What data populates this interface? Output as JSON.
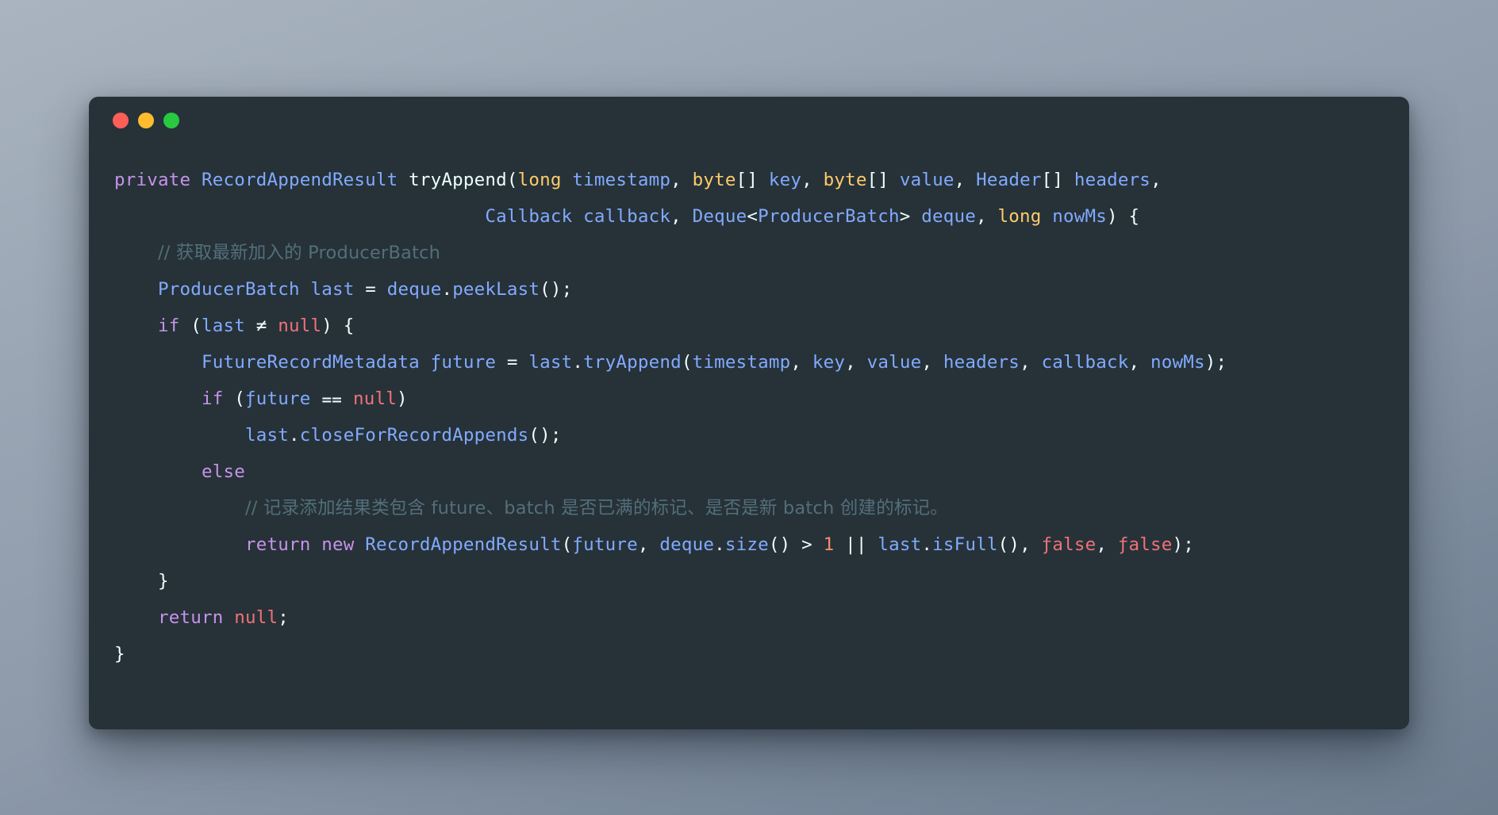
{
  "window": {
    "background_color": "#263238",
    "backdrop_color": "#8e9aaa",
    "traffic_lights": [
      {
        "name": "close",
        "color": "#ff5f57"
      },
      {
        "name": "minimize",
        "color": "#febc2e"
      },
      {
        "name": "maximize",
        "color": "#28c840"
      }
    ]
  },
  "theme": {
    "keyword": "#c792ea",
    "type": "#82aaff",
    "primitive": "#ffcb6b",
    "variable": "#82aaff",
    "null_literal": "#f07178",
    "number": "#f78c6c",
    "comment": "#546e7a",
    "plain": "#eeffff"
  },
  "code": {
    "language": "java",
    "lines": [
      {
        "indent": 0,
        "tokens": [
          {
            "t": "private",
            "c": "kw"
          },
          {
            "t": " ",
            "c": "pln"
          },
          {
            "t": "RecordAppendResult",
            "c": "typ"
          },
          {
            "t": " ",
            "c": "pln"
          },
          {
            "t": "tryAppend",
            "c": "fn"
          },
          {
            "t": "(",
            "c": "pln"
          },
          {
            "t": "long",
            "c": "prim"
          },
          {
            "t": " ",
            "c": "pln"
          },
          {
            "t": "timestamp",
            "c": "var"
          },
          {
            "t": ", ",
            "c": "pln"
          },
          {
            "t": "byte",
            "c": "prim"
          },
          {
            "t": "[] ",
            "c": "pln"
          },
          {
            "t": "key",
            "c": "var"
          },
          {
            "t": ", ",
            "c": "pln"
          },
          {
            "t": "byte",
            "c": "prim"
          },
          {
            "t": "[] ",
            "c": "pln"
          },
          {
            "t": "value",
            "c": "var"
          },
          {
            "t": ", ",
            "c": "pln"
          },
          {
            "t": "Header",
            "c": "typ"
          },
          {
            "t": "[] ",
            "c": "pln"
          },
          {
            "t": "headers",
            "c": "var"
          },
          {
            "t": ",",
            "c": "pln"
          }
        ]
      },
      {
        "indent": 0,
        "lead": "                                  ",
        "tokens": [
          {
            "t": "Callback",
            "c": "typ"
          },
          {
            "t": " ",
            "c": "pln"
          },
          {
            "t": "callback",
            "c": "var"
          },
          {
            "t": ", ",
            "c": "pln"
          },
          {
            "t": "Deque",
            "c": "typ"
          },
          {
            "t": "<",
            "c": "pln"
          },
          {
            "t": "ProducerBatch",
            "c": "typ"
          },
          {
            "t": "> ",
            "c": "pln"
          },
          {
            "t": "deque",
            "c": "var"
          },
          {
            "t": ", ",
            "c": "pln"
          },
          {
            "t": "long",
            "c": "prim"
          },
          {
            "t": " ",
            "c": "pln"
          },
          {
            "t": "nowMs",
            "c": "var"
          },
          {
            "t": ") {",
            "c": "pln"
          }
        ]
      },
      {
        "indent": 1,
        "tokens": [
          {
            "t": "// 获取最新加入的 ProducerBatch",
            "c": "cmt"
          }
        ]
      },
      {
        "indent": 1,
        "tokens": [
          {
            "t": "ProducerBatch",
            "c": "typ"
          },
          {
            "t": " ",
            "c": "pln"
          },
          {
            "t": "last",
            "c": "var"
          },
          {
            "t": " = ",
            "c": "pln"
          },
          {
            "t": "deque",
            "c": "var"
          },
          {
            "t": ".",
            "c": "pln"
          },
          {
            "t": "peekLast",
            "c": "mth"
          },
          {
            "t": "();",
            "c": "pln"
          }
        ]
      },
      {
        "indent": 1,
        "tokens": [
          {
            "t": "if",
            "c": "kw"
          },
          {
            "t": " (",
            "c": "pln"
          },
          {
            "t": "last",
            "c": "var"
          },
          {
            "t": " ≠ ",
            "c": "op"
          },
          {
            "t": "null",
            "c": "nul"
          },
          {
            "t": ") {",
            "c": "pln"
          }
        ]
      },
      {
        "indent": 2,
        "tokens": [
          {
            "t": "FutureRecordMetadata",
            "c": "typ"
          },
          {
            "t": " ",
            "c": "pln"
          },
          {
            "t": "ƒuture",
            "c": "var"
          },
          {
            "t": " = ",
            "c": "pln"
          },
          {
            "t": "last",
            "c": "var"
          },
          {
            "t": ".",
            "c": "pln"
          },
          {
            "t": "tryAppend",
            "c": "mth"
          },
          {
            "t": "(",
            "c": "pln"
          },
          {
            "t": "timestamp",
            "c": "var"
          },
          {
            "t": ", ",
            "c": "pln"
          },
          {
            "t": "key",
            "c": "var"
          },
          {
            "t": ", ",
            "c": "pln"
          },
          {
            "t": "value",
            "c": "var"
          },
          {
            "t": ", ",
            "c": "pln"
          },
          {
            "t": "headers",
            "c": "var"
          },
          {
            "t": ", ",
            "c": "pln"
          },
          {
            "t": "callback",
            "c": "var"
          },
          {
            "t": ", ",
            "c": "pln"
          },
          {
            "t": "nowMs",
            "c": "var"
          },
          {
            "t": ");",
            "c": "pln"
          }
        ]
      },
      {
        "indent": 2,
        "tokens": [
          {
            "t": "if",
            "c": "kw"
          },
          {
            "t": " (",
            "c": "pln"
          },
          {
            "t": "ƒuture",
            "c": "var"
          },
          {
            "t": " ⩵ ",
            "c": "op"
          },
          {
            "t": "null",
            "c": "nul"
          },
          {
            "t": ")",
            "c": "pln"
          }
        ]
      },
      {
        "indent": 3,
        "tokens": [
          {
            "t": "last",
            "c": "var"
          },
          {
            "t": ".",
            "c": "pln"
          },
          {
            "t": "closeForRecordAppends",
            "c": "mth"
          },
          {
            "t": "();",
            "c": "pln"
          }
        ]
      },
      {
        "indent": 2,
        "tokens": [
          {
            "t": "else",
            "c": "kw"
          }
        ]
      },
      {
        "indent": 3,
        "tokens": [
          {
            "t": "// 记录添加结果类包含 future、batch 是否已满的标记、是否是新 batch 创建的标记。",
            "c": "cmt"
          }
        ]
      },
      {
        "indent": 3,
        "tokens": [
          {
            "t": "return",
            "c": "kw"
          },
          {
            "t": " ",
            "c": "pln"
          },
          {
            "t": "new",
            "c": "kw"
          },
          {
            "t": " ",
            "c": "pln"
          },
          {
            "t": "RecordAppendResult",
            "c": "typ"
          },
          {
            "t": "(",
            "c": "pln"
          },
          {
            "t": "ƒuture",
            "c": "var"
          },
          {
            "t": ", ",
            "c": "pln"
          },
          {
            "t": "deque",
            "c": "var"
          },
          {
            "t": ".",
            "c": "pln"
          },
          {
            "t": "size",
            "c": "mth"
          },
          {
            "t": "() > ",
            "c": "pln"
          },
          {
            "t": "1",
            "c": "num"
          },
          {
            "t": " || ",
            "c": "pln"
          },
          {
            "t": "last",
            "c": "var"
          },
          {
            "t": ".",
            "c": "pln"
          },
          {
            "t": "isFull",
            "c": "mth"
          },
          {
            "t": "(), ",
            "c": "pln"
          },
          {
            "t": "ƒalse",
            "c": "nul"
          },
          {
            "t": ", ",
            "c": "pln"
          },
          {
            "t": "ƒalse",
            "c": "nul"
          },
          {
            "t": ");",
            "c": "pln"
          }
        ]
      },
      {
        "indent": 1,
        "tokens": [
          {
            "t": "}",
            "c": "pln"
          }
        ]
      },
      {
        "indent": 1,
        "tokens": [
          {
            "t": "return",
            "c": "kw"
          },
          {
            "t": " ",
            "c": "pln"
          },
          {
            "t": "null",
            "c": "nul"
          },
          {
            "t": ";",
            "c": "pln"
          }
        ]
      },
      {
        "indent": 0,
        "tokens": [
          {
            "t": "}",
            "c": "pln"
          }
        ]
      }
    ]
  }
}
